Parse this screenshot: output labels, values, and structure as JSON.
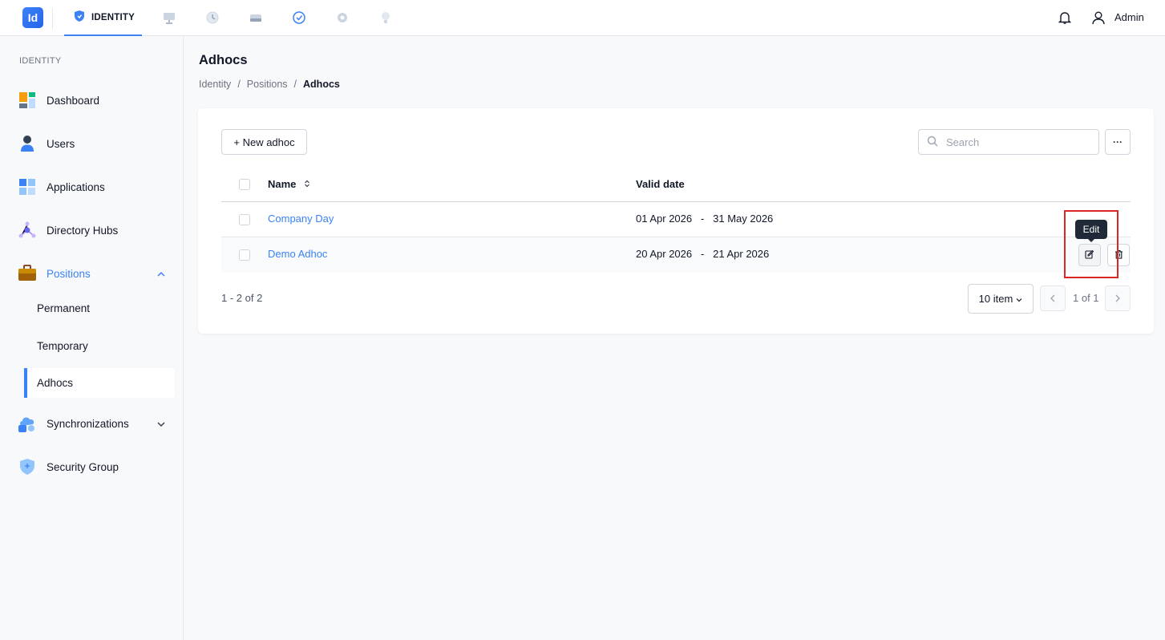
{
  "header": {
    "logo_text": "Id",
    "active_tab": "IDENTITY",
    "user_name": "Admin"
  },
  "sidebar": {
    "section": "IDENTITY",
    "items": [
      {
        "label": "Dashboard"
      },
      {
        "label": "Users"
      },
      {
        "label": "Applications"
      },
      {
        "label": "Directory Hubs"
      },
      {
        "label": "Positions"
      },
      {
        "label": "Synchronizations"
      },
      {
        "label": "Security Group"
      }
    ],
    "sub_items": [
      {
        "label": "Permanent"
      },
      {
        "label": "Temporary"
      },
      {
        "label": "Adhocs"
      }
    ]
  },
  "main": {
    "title": "Adhocs",
    "breadcrumb": [
      "Identity",
      "Positions",
      "Adhocs"
    ],
    "new_button": "+ New adhoc",
    "search_placeholder": "Search",
    "more_button": "···",
    "columns": {
      "name": "Name",
      "valid_date": "Valid date"
    },
    "rows": [
      {
        "name": "Company Day",
        "valid_date": "01 Apr 2026   -   31 May 2026"
      },
      {
        "name": "Demo Adhoc",
        "valid_date": "20 Apr 2026   -   21 Apr 2026"
      }
    ],
    "tooltip": "Edit",
    "summary": "1 - 2 of 2",
    "page_size": "10 item",
    "page_text": "1 of 1"
  },
  "colors": {
    "accent": "#3b82f6",
    "highlight": "#dc2626"
  }
}
